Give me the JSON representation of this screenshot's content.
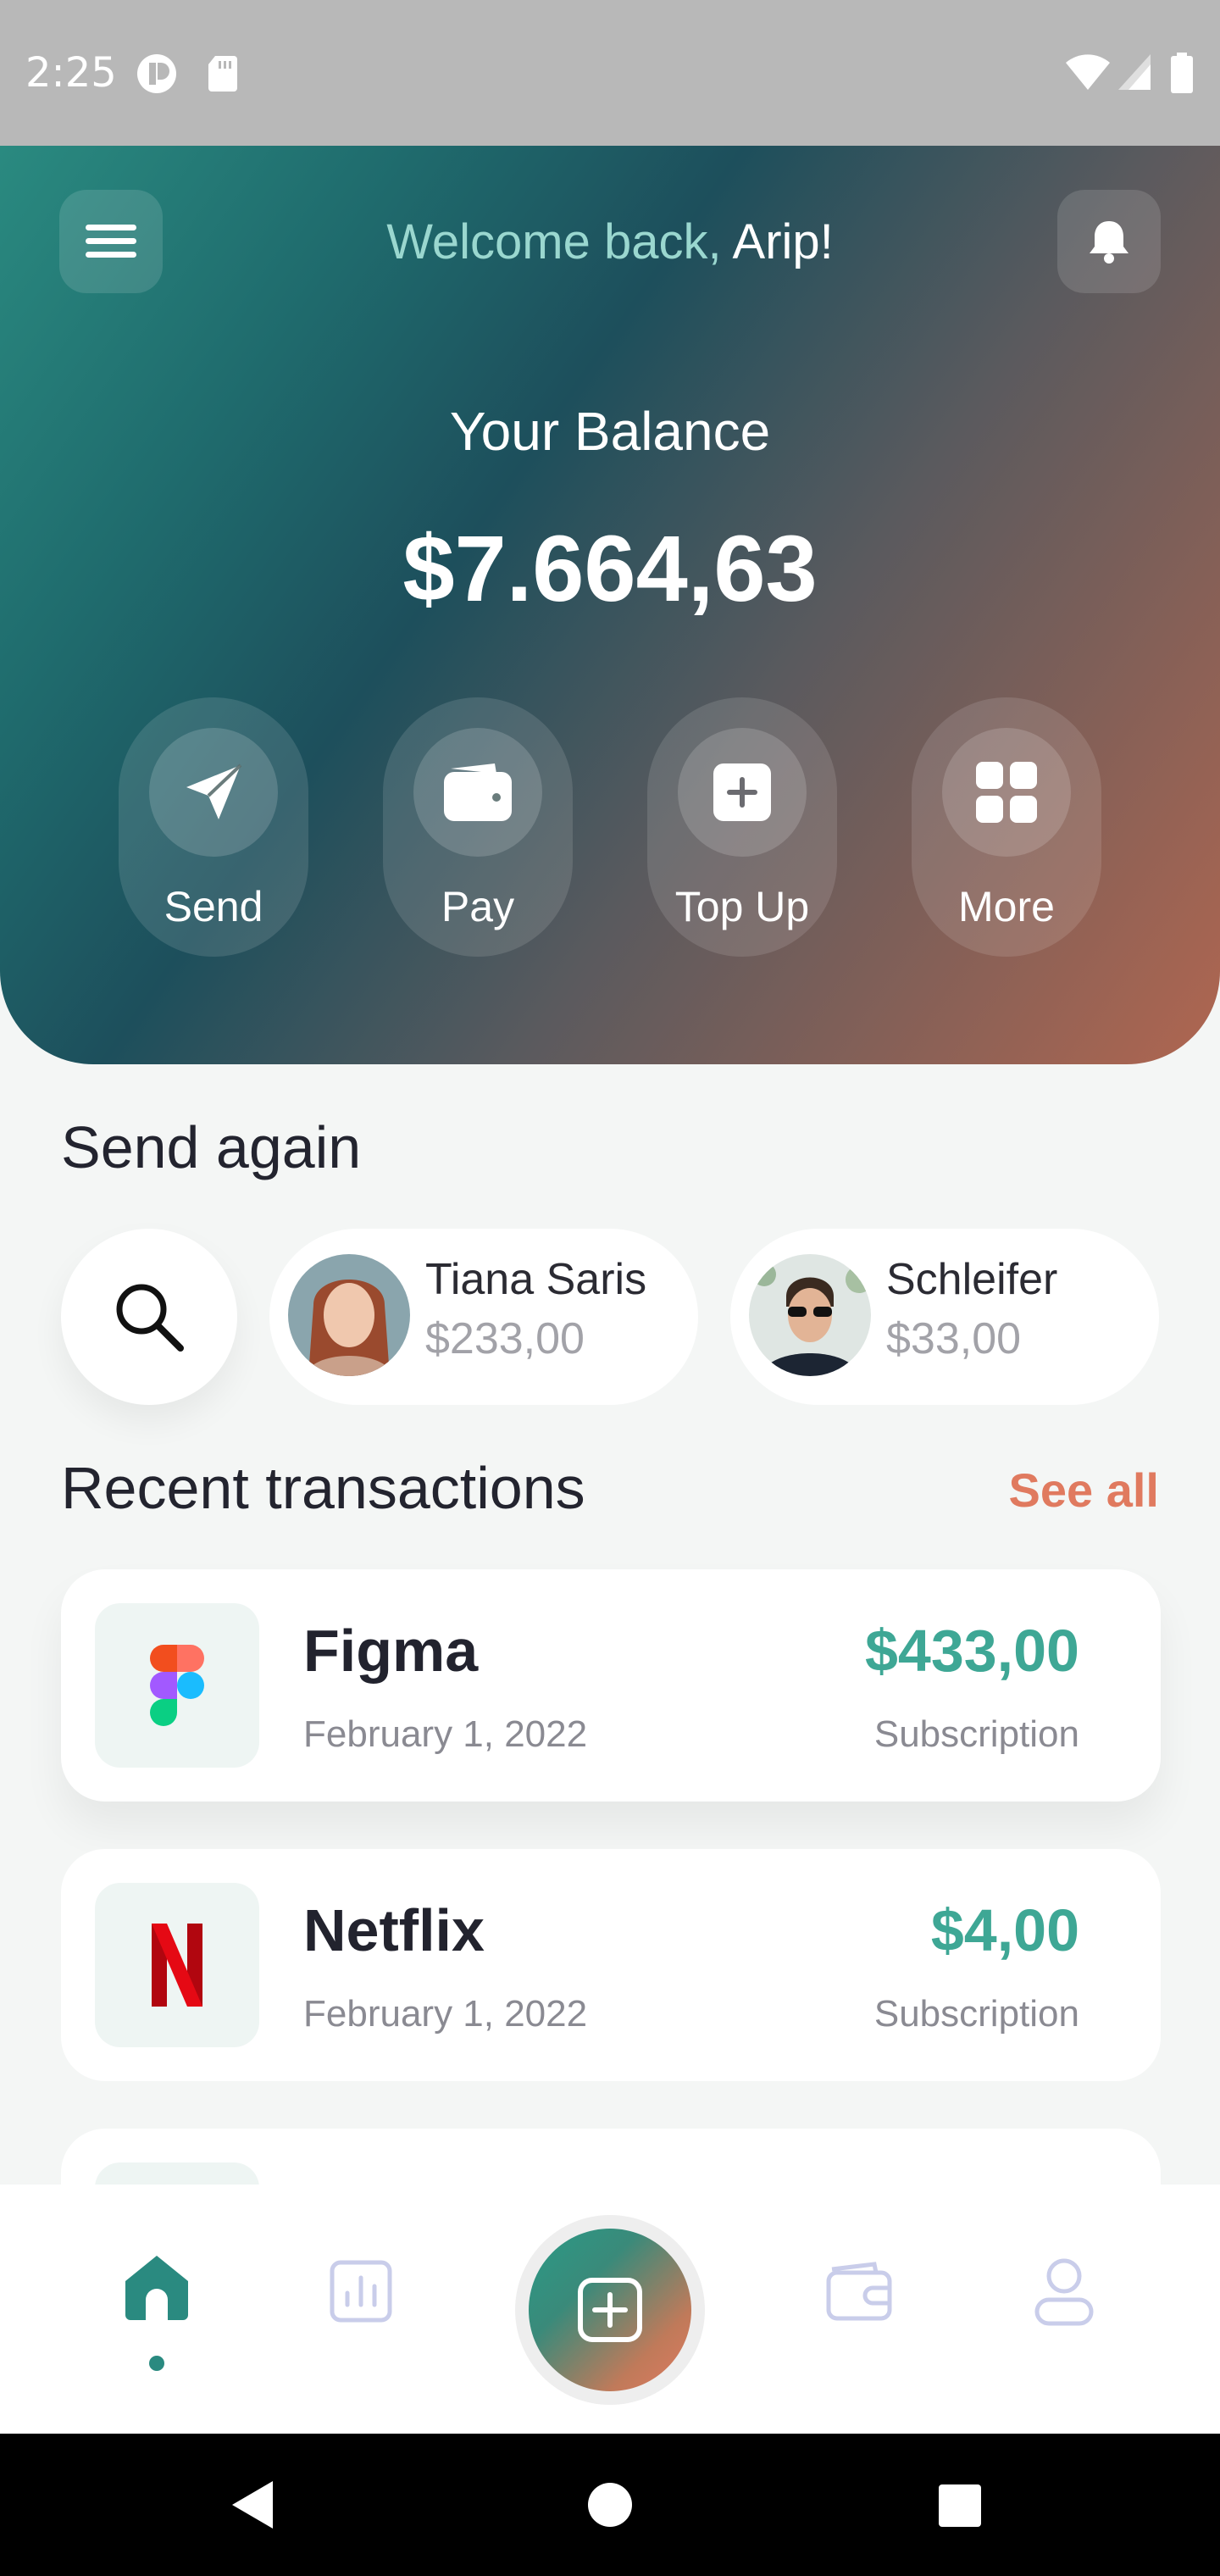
{
  "status_bar": {
    "time": "2:25"
  },
  "header": {
    "welcome_prefix": "Welcome back,",
    "user_name": "Arip!"
  },
  "balance": {
    "label": "Your Balance",
    "value": "$7.664,63"
  },
  "actions": [
    {
      "label": "Send",
      "icon": "send-icon"
    },
    {
      "label": "Pay",
      "icon": "wallet-icon"
    },
    {
      "label": "Top Up",
      "icon": "plus-square-icon"
    },
    {
      "label": "More",
      "icon": "grid-icon"
    }
  ],
  "send_again": {
    "title": "Send again",
    "contacts": [
      {
        "name": "Tiana Saris",
        "amount": "$233,00"
      },
      {
        "name": "Schleifer",
        "amount": "$33,00"
      }
    ]
  },
  "transactions": {
    "title": "Recent transactions",
    "see_all": "See all",
    "items": [
      {
        "name": "Figma",
        "date": "February 1, 2022",
        "amount": "$433,00",
        "type": "Subscription",
        "icon": "figma-logo"
      },
      {
        "name": "Netflix",
        "date": "February 1, 2022",
        "amount": "$4,00",
        "type": "Subscription",
        "icon": "netflix-logo"
      }
    ]
  },
  "bottom_nav": {
    "items": [
      "home-icon",
      "stats-icon",
      "add-icon",
      "wallet-icon",
      "profile-icon"
    ],
    "active": "home-icon"
  },
  "colors": {
    "accent": "#2a8a80",
    "amount": "#3ea795",
    "link": "#e07a5f",
    "title": "#23242f"
  }
}
